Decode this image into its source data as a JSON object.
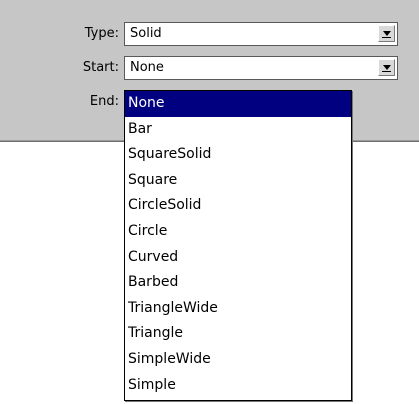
{
  "form": {
    "type": {
      "label": "Type:",
      "value": "Solid"
    },
    "start": {
      "label": "Start:",
      "value": "None"
    },
    "end": {
      "label": "End:"
    }
  },
  "dropdown": {
    "selected": "None",
    "options": [
      "None",
      "Bar",
      "SquareSolid",
      "Square",
      "CircleSolid",
      "Circle",
      "Curved",
      "Barbed",
      "TriangleWide",
      "Triangle",
      "SimpleWide",
      "Simple"
    ]
  }
}
